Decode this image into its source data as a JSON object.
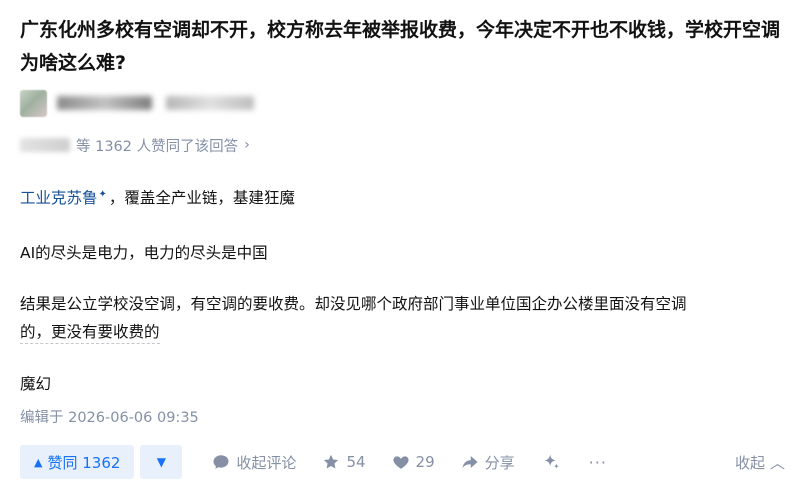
{
  "question": {
    "title": "广东化州多校有空调却不开，校方称去年被举报收费，今年决定不开也不收钱，学校开空调为啥这么难?"
  },
  "voters": {
    "text": "等 1362 人赞同了该回答",
    "arrow": "›"
  },
  "author": {
    "name": "工业克苏鲁",
    "badge_glyph": "✦",
    "headline": "，覆盖全产业链，基建狂魔"
  },
  "answer": {
    "paragraph1": "AI的尽头是电力，电力的尽头是中国",
    "paragraph2_line1": "结果是公立学校没空调，有空调的要收费。却没见哪个政府部门事业单位国企办公楼里面没有空调",
    "paragraph2_line2": "的，更没有要收费的",
    "paragraph3": "魔幻",
    "edited": "编辑于 2026-06-06 09:35"
  },
  "actions": {
    "vote_up_label": "赞同 1362",
    "vote_up_arrow": "▲",
    "vote_down_arrow": "▼",
    "comment_label": "收起评论",
    "favorite_count": "54",
    "like_count": "29",
    "share_label": "分享",
    "collapse_label": "收起",
    "collapse_arrow": "︿",
    "more_glyph": "···"
  },
  "colors": {
    "link": "#175199",
    "accent": "#1772f6",
    "muted": "#8590a6"
  }
}
